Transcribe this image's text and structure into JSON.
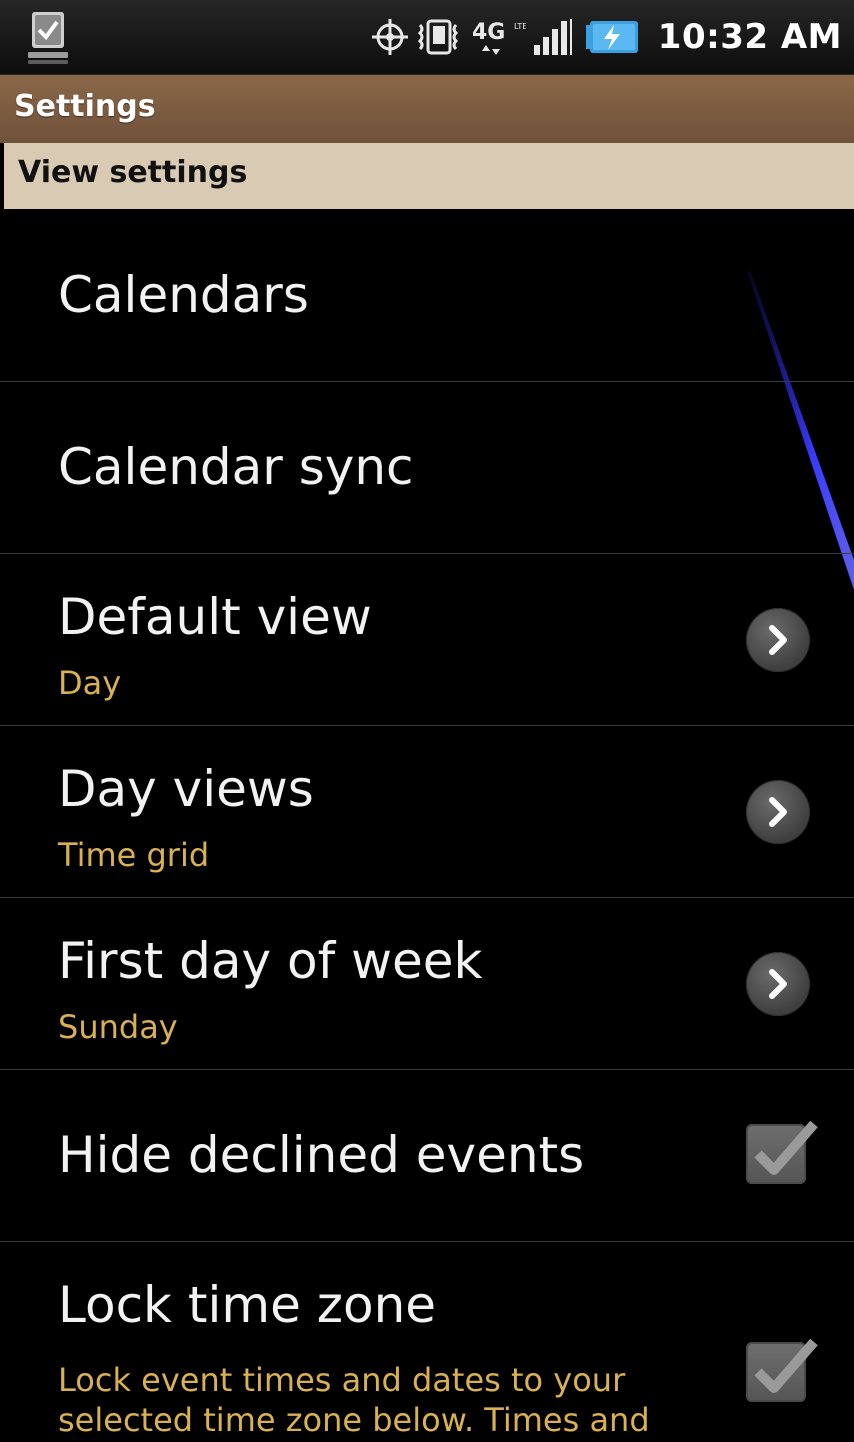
{
  "status_bar": {
    "time": "10:32 AM",
    "network_label": "4G",
    "network_sub": "LTE"
  },
  "title_bar": {
    "title": "Settings"
  },
  "section": {
    "header": "View settings"
  },
  "items": [
    {
      "title": "Calendars",
      "summary": "",
      "control": "none"
    },
    {
      "title": "Calendar sync",
      "summary": "",
      "control": "none"
    },
    {
      "title": "Default view",
      "summary": "Day",
      "control": "chevron"
    },
    {
      "title": "Day views",
      "summary": "Time grid",
      "control": "chevron"
    },
    {
      "title": "First day of week",
      "summary": "Sunday",
      "control": "chevron"
    },
    {
      "title": "Hide declined events",
      "summary": "",
      "control": "checkbox",
      "checked": true
    },
    {
      "title": "Lock time zone",
      "summary": "Lock event times and dates to your selected time zone below. Times and",
      "control": "checkbox",
      "checked": true
    }
  ],
  "colors": {
    "title_bar": "#7d5d42",
    "section_header": "#d9cab4",
    "summary_text": "#d9b052",
    "background": "#000000"
  },
  "icons": {
    "status_left": "download-complete-icon",
    "gps": "gps-icon",
    "vibrate": "vibrate-icon",
    "signal": "signal-strength-icon",
    "battery": "battery-charging-icon",
    "row_chevron": "chevron-right-icon",
    "row_checkbox": "checkbox-checked-icon"
  }
}
